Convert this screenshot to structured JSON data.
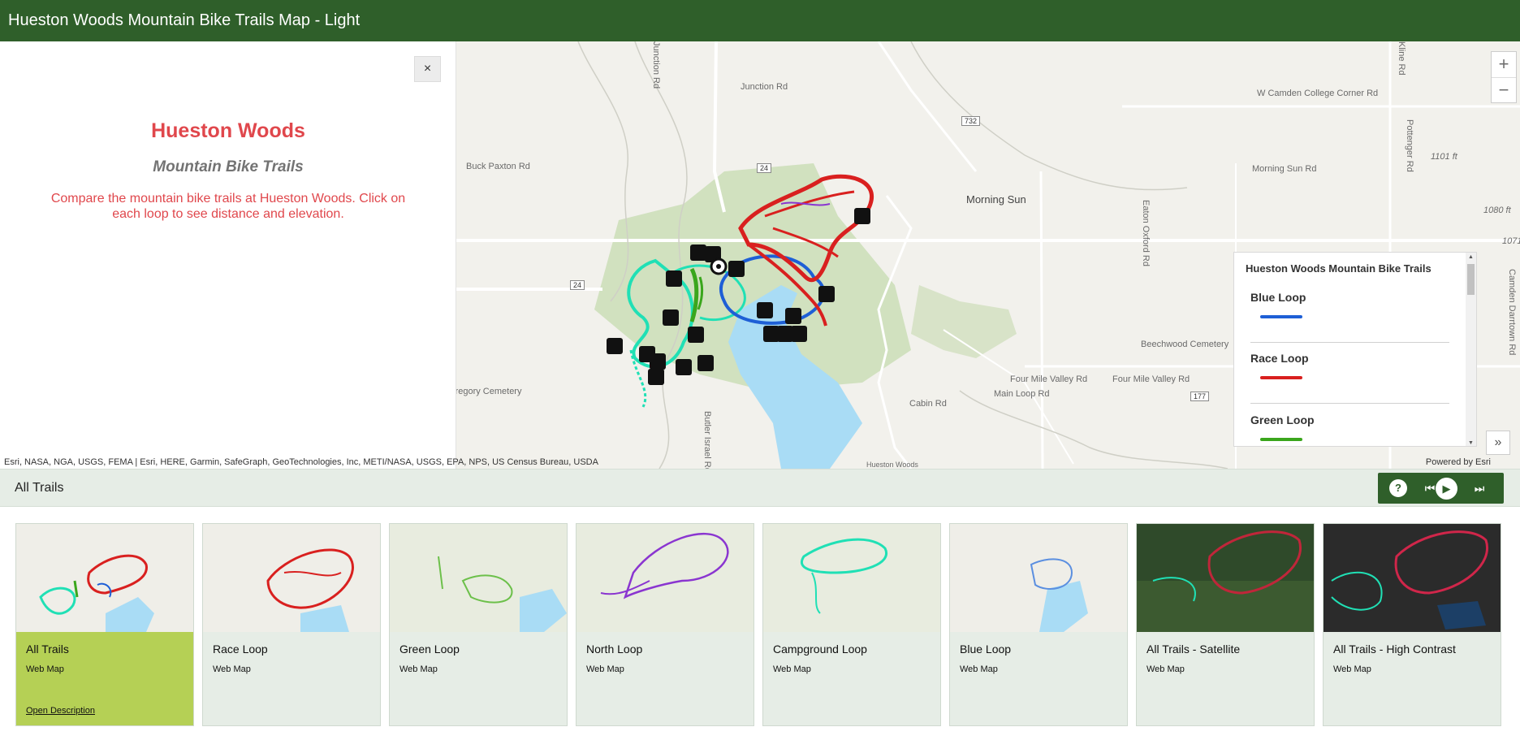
{
  "app": {
    "title": "Hueston Woods Mountain Bike Trails Map - Light"
  },
  "description": {
    "close_label": "×",
    "title": "Hueston Woods",
    "subtitle": "Mountain Bike Trails",
    "body": "Compare the mountain bike trails at Hueston Woods. Click on each loop to see distance and elevation."
  },
  "map": {
    "labels": {
      "junction_rd": "Junction Rd",
      "w_camden": "W Camden College Corner Rd",
      "buck_paxton": "Buck Paxton Rd",
      "morning_sun": "Morning Sun",
      "morning_sun_rd": "Morning Sun Rd",
      "four_mile": "Four Mile Valley Rd",
      "four_mile_2": "Four Mile Valley Rd",
      "beechwood": "Beechwood Cemetery",
      "cabin_rd": "Cabin Rd",
      "main_loop": "Main Loop Rd",
      "eaton_oxford": "Eaton Oxford Rd",
      "pottenger": "Pottenger Rd",
      "elev_1101": "1101 ft",
      "elev_1080": "1080 ft",
      "elev_1071": "1071",
      "camden_darrtown": "Camden Darrtown Rd",
      "kline": "Kline Rd",
      "junction_rd_v": "Junction Rd",
      "butler_israel": "Butler Israel Rd",
      "route_732": "732",
      "route_24a": "24",
      "route_24b": "24",
      "route_177": "177",
      "gregory": "Gregory Cemetery",
      "hueston_woods": "Hueston Woods"
    },
    "zoom_in": "+",
    "zoom_out": "−",
    "expand_icon": "»",
    "attribution": "Esri, NASA, NGA, USGS, FEMA | Esri, HERE, Garmin, SafeGraph, GeoTechnologies, Inc, METI/NASA, USGS, EPA, NPS, US Census Bureau, USDA",
    "powered_by": "Powered by Esri"
  },
  "legend": {
    "title": "Hueston Woods Mountain Bike Trails",
    "items": [
      {
        "label": "Blue Loop",
        "color": "#1e5fd6"
      },
      {
        "label": "Race Loop",
        "color": "#d9201f"
      },
      {
        "label": "Green Loop",
        "color": "#3aa61c"
      }
    ]
  },
  "tabbar": {
    "title": "All Trails",
    "help": "?",
    "prev": "⏮",
    "play": "▶",
    "next": "⏭"
  },
  "cards": [
    {
      "title": "All Trails",
      "subtitle": "Web Map",
      "link": "Open Description",
      "active": true
    },
    {
      "title": "Race Loop",
      "subtitle": "Web Map"
    },
    {
      "title": "Green Loop",
      "subtitle": "Web Map"
    },
    {
      "title": "North Loop",
      "subtitle": "Web Map"
    },
    {
      "title": "Campground Loop",
      "subtitle": "Web Map"
    },
    {
      "title": "Blue Loop",
      "subtitle": "Web Map"
    },
    {
      "title": "All Trails - Satellite",
      "subtitle": "Web Map"
    },
    {
      "title": "All Trails - High Contrast",
      "subtitle": "Web Map"
    }
  ],
  "colors": {
    "header": "#2f5f2a",
    "accent_red": "#e0474c",
    "active_card": "#b5d055",
    "card_bg": "#e6ede6",
    "water": "#a9dcf5",
    "park": "#c6dbb0",
    "teal_trail": "#20e0b5",
    "purple_trail": "#8a35d0"
  }
}
